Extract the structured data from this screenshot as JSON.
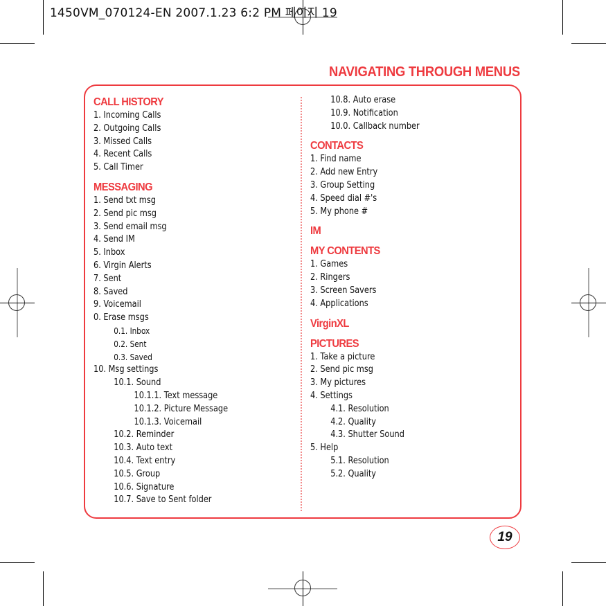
{
  "print_slug": "1450VM_070124-EN  2007.1.23 6:2 PM 페이지 19",
  "page_title": "NAVIGATING THROUGH MENUS",
  "page_number": "19",
  "accent_color": "#ee3a3f",
  "left_column": [
    {
      "type": "heading",
      "text": "CALL HISTORY"
    },
    {
      "type": "item",
      "level": 0,
      "text": "1. Incoming Calls"
    },
    {
      "type": "item",
      "level": 0,
      "text": "2. Outgoing Calls"
    },
    {
      "type": "item",
      "level": 0,
      "text": "3. Missed Calls"
    },
    {
      "type": "item",
      "level": 0,
      "text": "4. Recent Calls"
    },
    {
      "type": "item",
      "level": 0,
      "text": "5. Call Timer"
    },
    {
      "type": "heading",
      "text": "MESSAGING"
    },
    {
      "type": "item",
      "level": 0,
      "text": "1. Send txt msg"
    },
    {
      "type": "item",
      "level": 0,
      "text": "2. Send pic msg"
    },
    {
      "type": "item",
      "level": 0,
      "text": "3. Send email msg"
    },
    {
      "type": "item",
      "level": 0,
      "text": "4. Send IM"
    },
    {
      "type": "item",
      "level": 0,
      "text": "5. Inbox"
    },
    {
      "type": "item",
      "level": 0,
      "text": "6. Virgin Alerts"
    },
    {
      "type": "item",
      "level": 0,
      "text": "7. Sent"
    },
    {
      "type": "item",
      "level": 0,
      "text": "8. Saved"
    },
    {
      "type": "item",
      "level": 0,
      "text": "9. Voicemail"
    },
    {
      "type": "item",
      "level": 0,
      "text": "0. Erase msgs"
    },
    {
      "type": "item",
      "level": 1,
      "small": true,
      "text": "0.1. Inbox"
    },
    {
      "type": "item",
      "level": 1,
      "small": true,
      "text": "0.2. Sent"
    },
    {
      "type": "item",
      "level": 1,
      "small": true,
      "text": "0.3. Saved"
    },
    {
      "type": "item",
      "level": 0,
      "text": "10. Msg settings"
    },
    {
      "type": "item",
      "level": 1,
      "text": "10.1. Sound"
    },
    {
      "type": "item",
      "level": 2,
      "text": "10.1.1. Text message"
    },
    {
      "type": "item",
      "level": 2,
      "text": "10.1.2. Picture Message"
    },
    {
      "type": "item",
      "level": 2,
      "text": "10.1.3. Voicemail"
    },
    {
      "type": "item",
      "level": 1,
      "text": "10.2. Reminder"
    },
    {
      "type": "item",
      "level": 1,
      "text": "10.3. Auto text"
    },
    {
      "type": "item",
      "level": 1,
      "text": "10.4. Text entry"
    },
    {
      "type": "item",
      "level": 1,
      "text": "10.5. Group"
    },
    {
      "type": "item",
      "level": 1,
      "text": "10.6. Signature"
    },
    {
      "type": "item",
      "level": 1,
      "text": "10.7. Save to Sent folder"
    }
  ],
  "right_column": [
    {
      "type": "item",
      "level": 1,
      "text": "10.8. Auto erase"
    },
    {
      "type": "item",
      "level": 1,
      "text": "10.9. Notification"
    },
    {
      "type": "item",
      "level": 1,
      "text": "10.0. Callback number"
    },
    {
      "type": "heading",
      "text": "CONTACTS"
    },
    {
      "type": "item",
      "level": 0,
      "text": "1. Find name"
    },
    {
      "type": "item",
      "level": 0,
      "text": "2. Add new Entry"
    },
    {
      "type": "item",
      "level": 0,
      "text": "3. Group Setting"
    },
    {
      "type": "item",
      "level": 0,
      "text": "4. Speed dial #'s"
    },
    {
      "type": "item",
      "level": 0,
      "text": "5. My phone #"
    },
    {
      "type": "heading",
      "text": "IM"
    },
    {
      "type": "heading",
      "text": "MY CONTENTS"
    },
    {
      "type": "item",
      "level": 0,
      "text": "1. Games"
    },
    {
      "type": "item",
      "level": 0,
      "text": "2. Ringers"
    },
    {
      "type": "item",
      "level": 0,
      "text": "3. Screen Savers"
    },
    {
      "type": "item",
      "level": 0,
      "text": "4. Applications"
    },
    {
      "type": "heading",
      "text": "VirginXL"
    },
    {
      "type": "heading",
      "text": "PICTURES"
    },
    {
      "type": "item",
      "level": 0,
      "text": "1. Take a picture"
    },
    {
      "type": "item",
      "level": 0,
      "text": "2. Send pic msg"
    },
    {
      "type": "item",
      "level": 0,
      "text": "3. My pictures"
    },
    {
      "type": "item",
      "level": 0,
      "text": "4. Settings"
    },
    {
      "type": "item",
      "level": 1,
      "text": "4.1. Resolution"
    },
    {
      "type": "item",
      "level": 1,
      "text": "4.2. Quality"
    },
    {
      "type": "item",
      "level": 1,
      "text": "4.3. Shutter Sound"
    },
    {
      "type": "item",
      "level": 0,
      "text": "5. Help"
    },
    {
      "type": "item",
      "level": 1,
      "text": "5.1. Resolution"
    },
    {
      "type": "item",
      "level": 1,
      "text": "5.2. Quality"
    }
  ]
}
